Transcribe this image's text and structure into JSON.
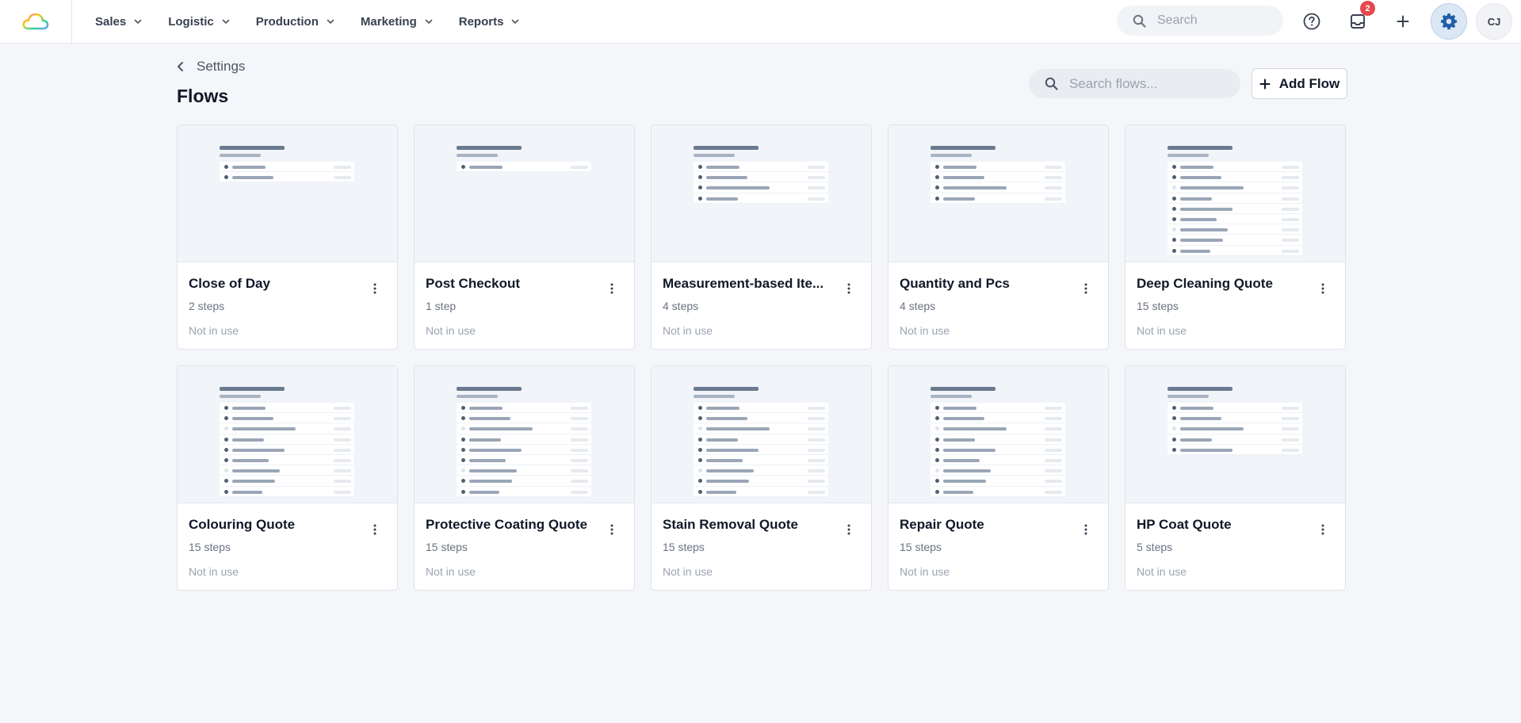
{
  "topbar": {
    "logo_icon": "cloud-logo-icon",
    "nav": [
      {
        "label": "Sales"
      },
      {
        "label": "Logistic"
      },
      {
        "label": "Production"
      },
      {
        "label": "Marketing"
      },
      {
        "label": "Reports"
      }
    ],
    "search_placeholder": "Search",
    "notification_count": "2",
    "avatar_initials": "CJ"
  },
  "page": {
    "back_label": "Settings",
    "title": "Flows",
    "search_placeholder": "Search flows...",
    "add_button_label": "Add Flow"
  },
  "flows": [
    {
      "name": "Close of Day",
      "steps": "2 steps",
      "status": "Not in use",
      "preview_rows": 2
    },
    {
      "name": "Post Checkout",
      "steps": "1 step",
      "status": "Not in use",
      "preview_rows": 1
    },
    {
      "name": "Measurement-based Ite...",
      "steps": "4 steps",
      "status": "Not in use",
      "preview_rows": 4
    },
    {
      "name": "Quantity and Pcs",
      "steps": "4 steps",
      "status": "Not in use",
      "preview_rows": 4
    },
    {
      "name": "Deep Cleaning Quote",
      "steps": "15 steps",
      "status": "Not in use",
      "preview_rows": 9
    },
    {
      "name": "Colouring Quote",
      "steps": "15 steps",
      "status": "Not in use",
      "preview_rows": 9
    },
    {
      "name": "Protective Coating Quote",
      "steps": "15 steps",
      "status": "Not in use",
      "preview_rows": 9
    },
    {
      "name": "Stain Removal Quote",
      "steps": "15 steps",
      "status": "Not in use",
      "preview_rows": 9
    },
    {
      "name": "Repair Quote",
      "steps": "15 steps",
      "status": "Not in use",
      "preview_rows": 9
    },
    {
      "name": "HP Coat Quote",
      "steps": "5 steps",
      "status": "Not in use",
      "preview_rows": 5
    }
  ],
  "colors": {
    "accent": "#1f5fa8",
    "badge": "#e5484d",
    "background": "#f4f6f9"
  }
}
